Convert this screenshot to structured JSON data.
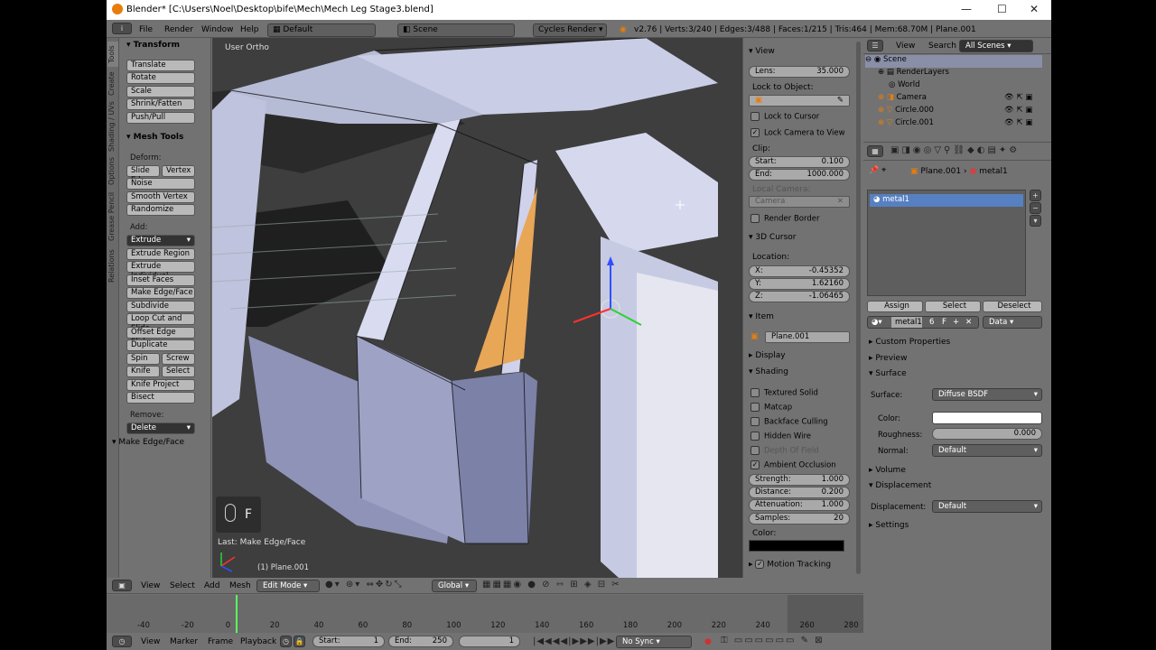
{
  "window": {
    "title": "Blender* [C:\\Users\\Noel\\Desktop\\bife\\Mech\\Mech Leg Stage3.blend]",
    "minimize": "—",
    "maximize": "☐",
    "close": "✕"
  },
  "info_bar": {
    "menus": [
      "File",
      "Render",
      "Window",
      "Help"
    ],
    "layout": "Default",
    "scene": "Scene",
    "engine": "Cycles Render",
    "stats": "v2.76 | Verts:3/240 | Edges:3/488 | Faces:1/215 | Tris:464 | Mem:68.70M | Plane.001"
  },
  "tool_tabs": [
    "Tools",
    "Create",
    "Shading / UVs",
    "Options",
    "Grease Pencil",
    "Relations"
  ],
  "tool_shelf": {
    "transform_header": "Transform",
    "transform": [
      "Translate",
      "Rotate",
      "Scale",
      "Shrink/Fatten",
      "Push/Pull"
    ],
    "mesh_tools_header": "Mesh Tools",
    "deform_label": "Deform:",
    "deform_pair": [
      "Slide Ed",
      "Vertex"
    ],
    "deform": [
      "Noise",
      "Smooth Vertex",
      "Randomize"
    ],
    "add_label": "Add:",
    "extrude": "Extrude",
    "add": [
      "Extrude Region",
      "Extrude Individual",
      "Inset Faces",
      "Make Edge/Face",
      "Subdivide",
      "Loop Cut and Slide",
      "Offset Edge Slide",
      "Duplicate"
    ],
    "spin_pair": [
      "Spin",
      "Screw"
    ],
    "knife_pair": [
      "Knife",
      "Select"
    ],
    "add2": [
      "Knife Project",
      "Bisect"
    ],
    "remove_label": "Remove:",
    "delete": "Delete",
    "operator_header": "Make Edge/Face"
  },
  "viewport": {
    "view_label": "User Ortho",
    "key": "F",
    "last_op": "Last: Make Edge/Face",
    "object": "(1) Plane.001"
  },
  "n_panel": {
    "view_header": "View",
    "lens_label": "Lens:",
    "lens": "35.000",
    "lock_label": "Lock to Object:",
    "lock_cursor": "Lock to Cursor",
    "lock_camera": "Lock Camera to View",
    "clip_label": "Clip:",
    "start_label": "Start:",
    "start": "0.100",
    "end_label": "End:",
    "end": "1000.000",
    "local_camera": "Local Camera:",
    "camera": "Camera",
    "render_border": "Render Border",
    "cursor_header": "3D Cursor",
    "location_label": "Location:",
    "x_label": "X:",
    "x": "-0.45352",
    "y_label": "Y:",
    "y": "1.62160",
    "z_label": "Z:",
    "z": "-1.06465",
    "item_header": "Item",
    "item_name": "Plane.001",
    "display_header": "Display",
    "shading_header": "Shading",
    "shading_opts": [
      "Textured Solid",
      "Matcap",
      "Backface Culling",
      "Hidden Wire",
      "Depth Of Field",
      "Ambient Occlusion"
    ],
    "strength_label": "Strength:",
    "strength": "1.000",
    "distance_label": "Distance:",
    "distance": "0.200",
    "attenuation_label": "Attenuation:",
    "attenuation": "1.000",
    "samples_label": "Samples:",
    "samples": "20",
    "color_label": "Color:",
    "motion_tracking": "Motion Tracking"
  },
  "outliner": {
    "view": "View",
    "search": "Search",
    "scenes": "All Scenes",
    "rows": [
      "Scene",
      "RenderLayers",
      "World",
      "Camera",
      "Circle.000",
      "Circle.001"
    ]
  },
  "properties": {
    "breadcrumb": [
      "Plane.001",
      "metal1"
    ],
    "slot": "metal1",
    "assign": "Assign",
    "select": "Select",
    "deselect": "Deselect",
    "material": "metal1",
    "users": "6",
    "fake": "F",
    "link": "Data",
    "panels": [
      "Custom Properties",
      "Preview",
      "Surface"
    ],
    "surface_label": "Surface:",
    "surface": "Diffuse BSDF",
    "color_label": "Color:",
    "roughness_label": "Roughness:",
    "roughness": "0.000",
    "normal_label": "Normal:",
    "normal": "Default",
    "volume": "Volume",
    "displacement_header": "Displacement",
    "displacement_label": "Displacement:",
    "displacement": "Default",
    "settings": "Settings"
  },
  "v3d_header": {
    "menus": [
      "View",
      "Select",
      "Add",
      "Mesh"
    ],
    "mode": "Edit Mode",
    "orientation": "Global"
  },
  "timeline": {
    "ticks": [
      "-40",
      "-20",
      "0",
      "20",
      "40",
      "60",
      "80",
      "100",
      "120",
      "140",
      "160",
      "180",
      "200",
      "220",
      "240",
      "260",
      "280"
    ],
    "menus": [
      "View",
      "Marker",
      "Frame",
      "Playback"
    ],
    "start_label": "Start:",
    "start": "1",
    "end_label": "End:",
    "end": "250",
    "current": "1",
    "sync": "No Sync"
  },
  "colors": {
    "panel": "#727272",
    "viewport": "#3e3e3e",
    "selected_face": "#e0a050",
    "accent": "#4a90e2"
  }
}
